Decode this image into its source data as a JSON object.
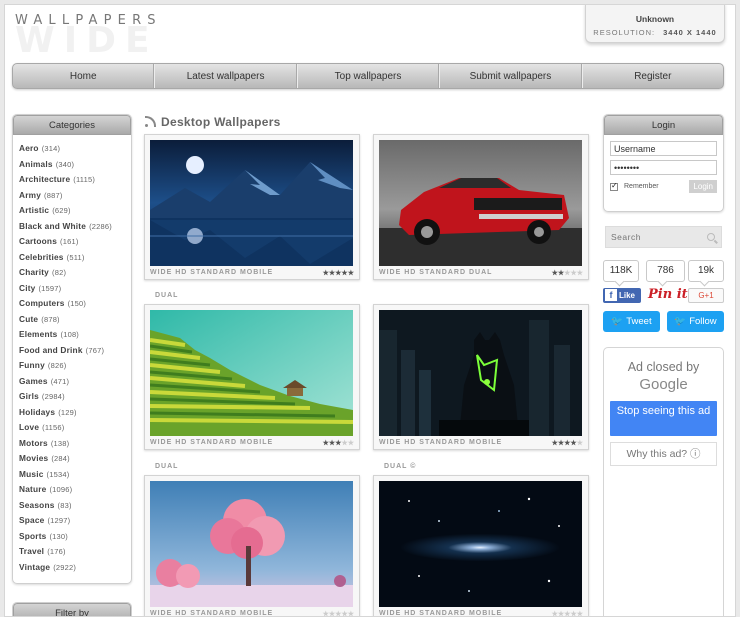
{
  "header": {
    "logo_top": "WALLPAPERS",
    "logo_big": "WIDE",
    "user": "Unknown",
    "resolution_label": "RESOLUTION:",
    "resolution_value": "3440 X 1440"
  },
  "nav": [
    "Home",
    "Latest wallpapers",
    "Top wallpapers",
    "Submit wallpapers",
    "Register"
  ],
  "categories": {
    "title": "Categories",
    "items": [
      {
        "name": "Aero",
        "count": "(314)"
      },
      {
        "name": "Animals",
        "count": "(340)"
      },
      {
        "name": "Architecture",
        "count": "(1115)"
      },
      {
        "name": "Army",
        "count": "(887)"
      },
      {
        "name": "Artistic",
        "count": "(629)"
      },
      {
        "name": "Black and White",
        "count": "(2286)"
      },
      {
        "name": "Cartoons",
        "count": "(161)"
      },
      {
        "name": "Celebrities",
        "count": "(511)"
      },
      {
        "name": "Charity",
        "count": "(82)"
      },
      {
        "name": "City",
        "count": "(1597)"
      },
      {
        "name": "Computers",
        "count": "(150)"
      },
      {
        "name": "Cute",
        "count": "(878)"
      },
      {
        "name": "Elements",
        "count": "(108)"
      },
      {
        "name": "Food and Drink",
        "count": "(767)"
      },
      {
        "name": "Funny",
        "count": "(826)"
      },
      {
        "name": "Games",
        "count": "(471)"
      },
      {
        "name": "Girls",
        "count": "(2984)"
      },
      {
        "name": "Holidays",
        "count": "(129)"
      },
      {
        "name": "Love",
        "count": "(1156)"
      },
      {
        "name": "Motors",
        "count": "(138)"
      },
      {
        "name": "Movies",
        "count": "(284)"
      },
      {
        "name": "Music",
        "count": "(1534)"
      },
      {
        "name": "Nature",
        "count": "(1096)"
      },
      {
        "name": "Seasons",
        "count": "(83)"
      },
      {
        "name": "Space",
        "count": "(1297)"
      },
      {
        "name": "Sports",
        "count": "(130)"
      },
      {
        "name": "Travel",
        "count": "(176)"
      },
      {
        "name": "Vintage",
        "count": "(2922)"
      }
    ],
    "filter_title": "Filter by"
  },
  "main": {
    "title": "Desktop Wallpapers",
    "wallpapers": [
      {
        "tags": "WIDE HD STANDARD MOBILE",
        "sub": "DUAL",
        "rating": 4.5
      },
      {
        "tags": "WIDE HD STANDARD DUAL",
        "sub": "",
        "rating": 1.5
      },
      {
        "tags": "WIDE HD STANDARD MOBILE",
        "sub": "DUAL",
        "rating": 2.5
      },
      {
        "tags": "WIDE HD STANDARD MOBILE",
        "sub": "DUAL ©",
        "rating": 3.5
      },
      {
        "tags": "WIDE HD STANDARD MOBILE",
        "sub": "",
        "rating": 0
      },
      {
        "tags": "WIDE HD STANDARD MOBILE",
        "sub": "",
        "rating": 0
      }
    ]
  },
  "login": {
    "title": "Login",
    "username": "Username",
    "password": "••••••••",
    "remember": "Remember",
    "button": "Login"
  },
  "search": {
    "placeholder": "Search"
  },
  "social": {
    "counts": [
      "118K",
      "786",
      "19k"
    ],
    "fb_like": "Like",
    "pin": "Pin it",
    "gplus": "G+1",
    "tweet": "Tweet",
    "follow": "Follow"
  },
  "ad": {
    "closed_by": "Ad closed by",
    "brand": "Google",
    "stop": "Stop seeing this ad",
    "why": "Why this ad? ⓘ"
  }
}
